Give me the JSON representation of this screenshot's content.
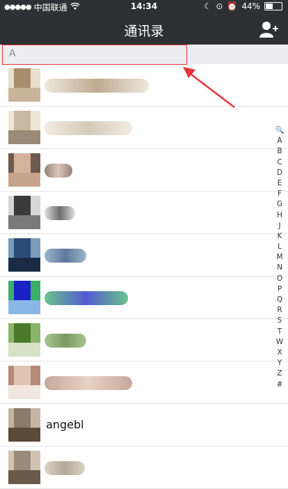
{
  "status": {
    "carrier": "中国联通",
    "time": "14:34",
    "battery": "44%",
    "battery_level": 0.44
  },
  "nav": {
    "title": "通讯录",
    "add_icon": "add-contact-icon"
  },
  "section": {
    "letter": "A"
  },
  "annotation": {
    "color": "#e8333a"
  },
  "contacts": [
    {
      "name": "",
      "colors": [
        "#a98e6c",
        "#e8dfcf",
        "#c9b49a"
      ]
    },
    {
      "name": "",
      "colors": [
        "#c8b8a0",
        "#efe6da",
        "#9a8a78"
      ]
    },
    {
      "name": "",
      "colors": [
        "#d6b29b",
        "#6e5a4e",
        "#c6a48c"
      ]
    },
    {
      "name": "",
      "colors": [
        "#3a3a3a",
        "#d6d6d6",
        "#7a7a7a"
      ]
    },
    {
      "name": "",
      "colors": [
        "#2a4c7a",
        "#7a9cba",
        "#1a2c44"
      ]
    },
    {
      "name": "",
      "colors": [
        "#1a22c4",
        "#3ab066",
        "#8ab6e6"
      ]
    },
    {
      "name": "",
      "colors": [
        "#4a7a2a",
        "#8ab46a",
        "#d6e2c4"
      ]
    },
    {
      "name": "",
      "colors": [
        "#dfc4b2",
        "#b48a7a",
        "#f2e6de"
      ]
    },
    {
      "name": "angebl",
      "colors": [
        "#8a7a6a",
        "#c4b4a4",
        "#5a4a3a"
      ]
    },
    {
      "name": "",
      "colors": [
        "#9a8a7a",
        "#d2c2b2",
        "#6a5a4a"
      ]
    }
  ],
  "index": [
    "🔍",
    "A",
    "B",
    "C",
    "D",
    "E",
    "F",
    "G",
    "H",
    "J",
    "K",
    "L",
    "M",
    "N",
    "O",
    "P",
    "Q",
    "R",
    "S",
    "T",
    "W",
    "X",
    "Y",
    "Z",
    "#"
  ]
}
